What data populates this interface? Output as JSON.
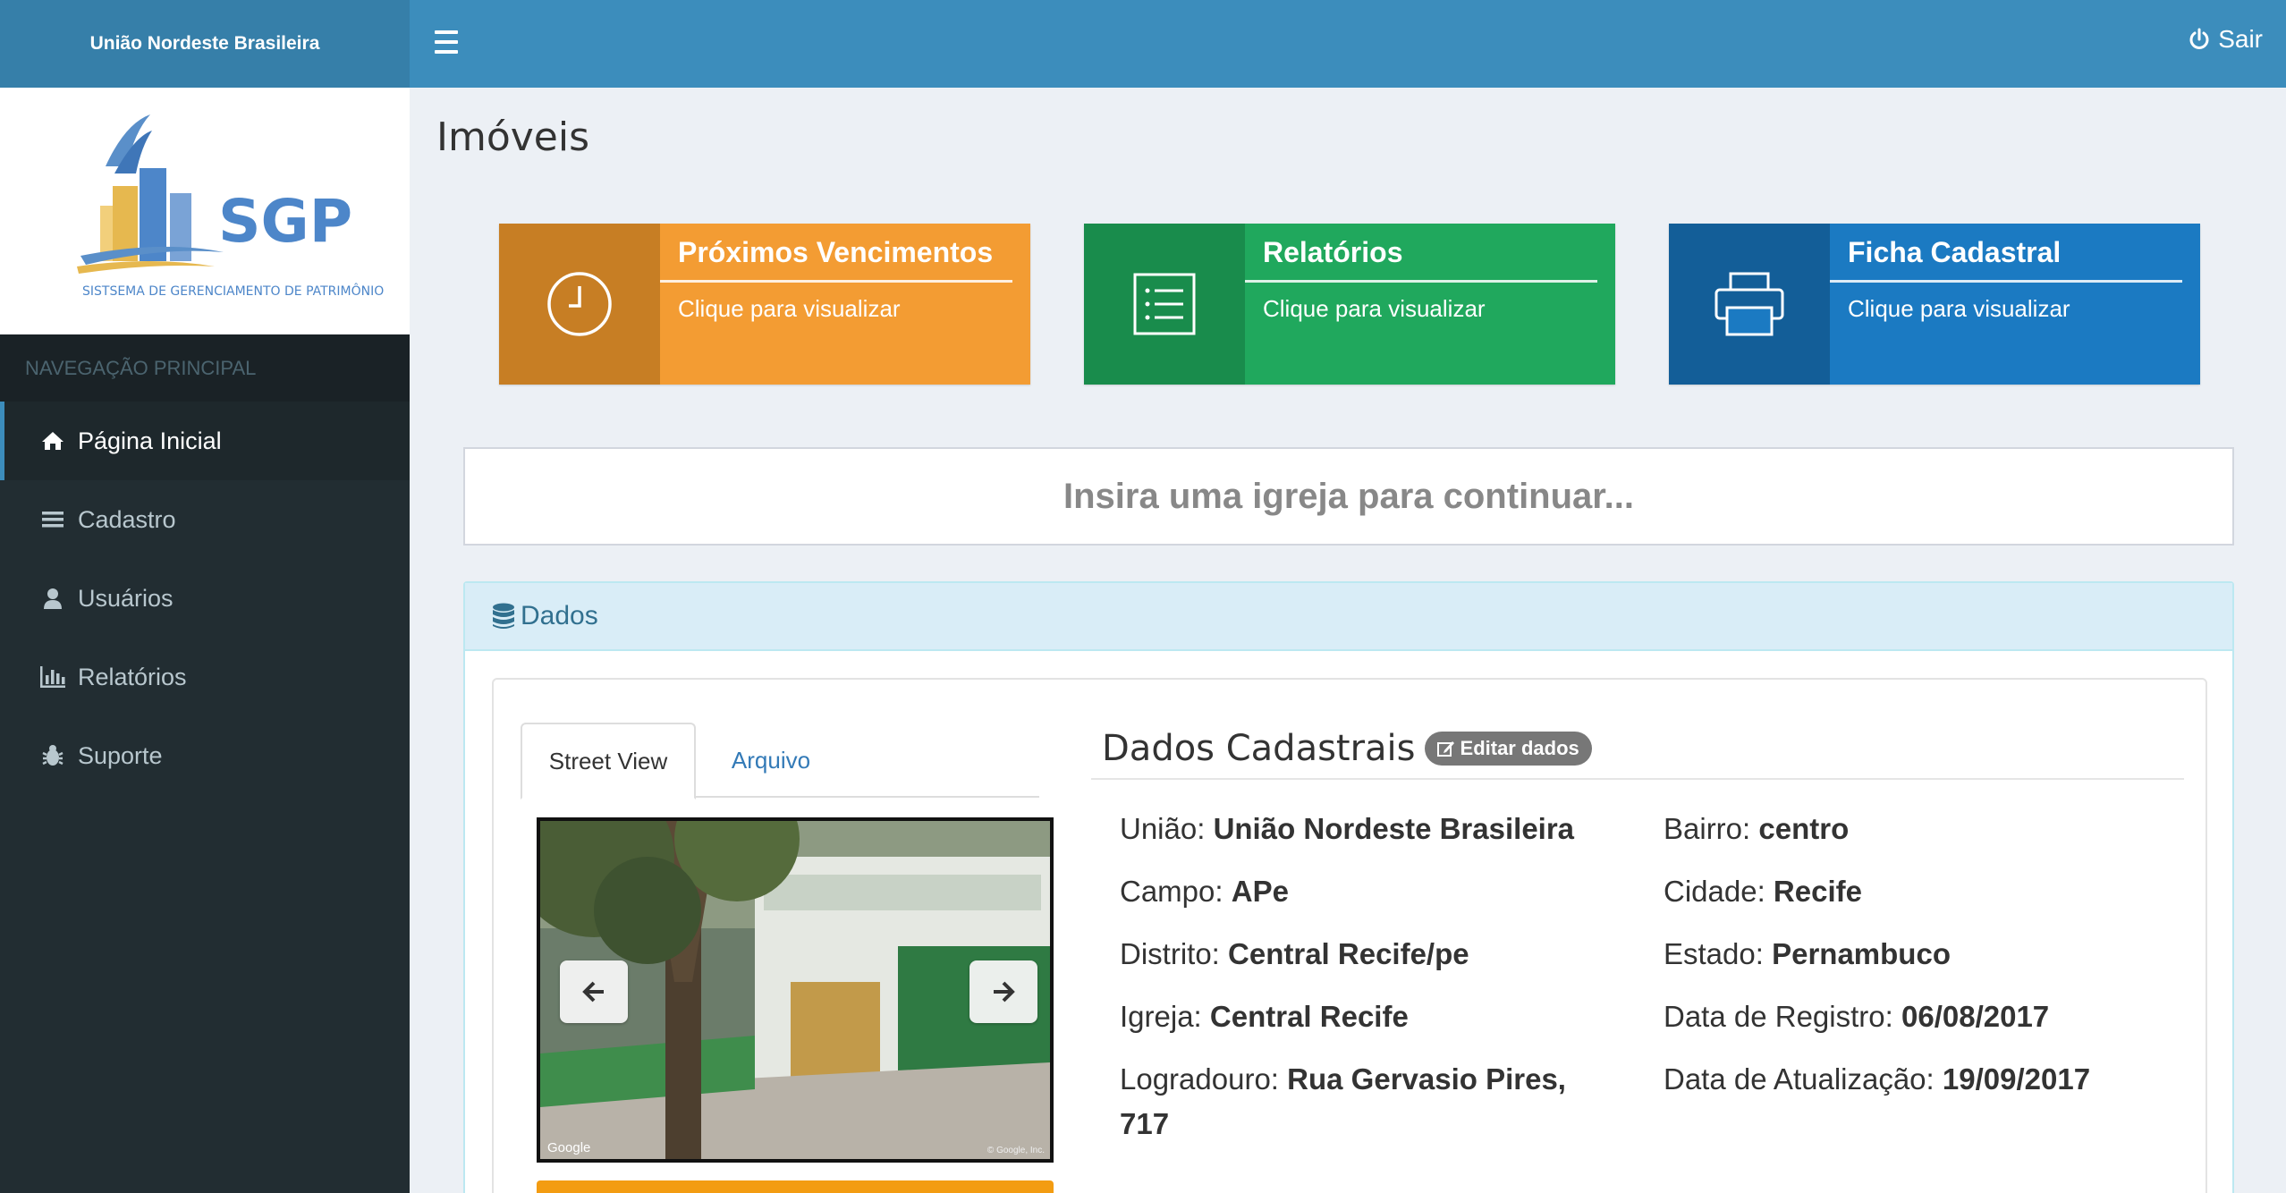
{
  "brand": "União Nordeste Brasileira",
  "logo": {
    "text": "SGP",
    "subtitle": "SISTSEMA DE GERENCIAMENTO DE PATRIMÔNIO"
  },
  "sidebar": {
    "header": "NAVEGAÇÃO PRINCIPAL",
    "items": [
      {
        "label": "Página Inicial",
        "icon": "home-icon"
      },
      {
        "label": "Cadastro",
        "icon": "list-icon"
      },
      {
        "label": "Usuários",
        "icon": "user-icon"
      },
      {
        "label": "Relatórios",
        "icon": "bar-chart-icon"
      },
      {
        "label": "Suporte",
        "icon": "bug-icon"
      }
    ]
  },
  "topbar": {
    "logout_label": "Sair"
  },
  "page": {
    "title": "Imóveis"
  },
  "cards": [
    {
      "title": "Próximos Vencimentos",
      "subtitle": "Clique para visualizar",
      "color": "#f39c33",
      "icon_bg": "#c77e24",
      "icon": "clock-icon"
    },
    {
      "title": "Relatórios",
      "subtitle": "Clique para visualizar",
      "color": "#20a85d",
      "icon_bg": "#198c4c",
      "icon": "list-icon"
    },
    {
      "title": "Ficha Cadastral",
      "subtitle": "Clique para visualizar",
      "color": "#1b7ac2",
      "icon_bg": "#135e98",
      "icon": "print-icon"
    }
  ],
  "prompt": "Insira uma igreja para continuar...",
  "panel": {
    "heading": "Dados"
  },
  "tabs": {
    "active": "Street View",
    "other": "Arquivo"
  },
  "streetview": {
    "google": "Google",
    "copyright": "© Google, Inc."
  },
  "dados": {
    "title": "Dados Cadastrais",
    "edit_label": "Editar dados",
    "fields": {
      "uniao": {
        "label": "União:",
        "value": "União Nordeste Brasileira"
      },
      "campo": {
        "label": "Campo:",
        "value": "APe"
      },
      "distrito": {
        "label": "Distrito:",
        "value": "Central Recife/pe"
      },
      "igreja": {
        "label": "Igreja:",
        "value": "Central Recife"
      },
      "logradouro": {
        "label": "Logradouro:",
        "value": "Rua Gervasio Pires,",
        "value2": "717"
      },
      "bairro": {
        "label": "Bairro:",
        "value": "centro"
      },
      "cidade": {
        "label": "Cidade:",
        "value": "Recife"
      },
      "estado": {
        "label": "Estado:",
        "value": "Pernambuco"
      },
      "registro": {
        "label": "Data de Registro:",
        "value": "06/08/2017"
      },
      "atualizacao": {
        "label": "Data de Atualização:",
        "value": "19/09/2017"
      }
    }
  }
}
